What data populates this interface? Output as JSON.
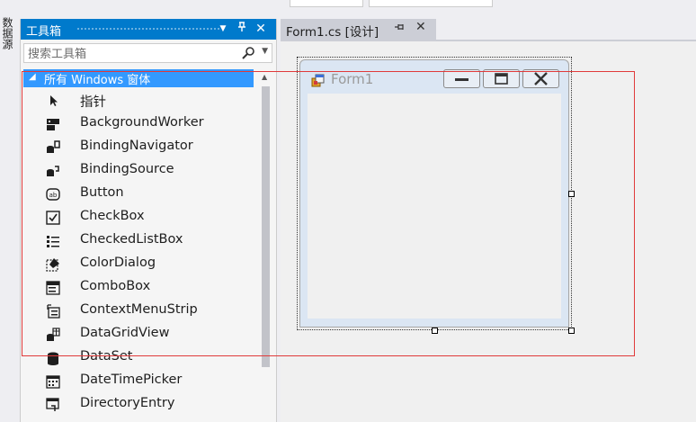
{
  "side_strip": {
    "tab_label": "数据源"
  },
  "toolbox": {
    "title": "工具箱",
    "title_buttons": [
      "▼",
      "📌",
      "✕"
    ],
    "search_placeholder": "搜索工具箱",
    "group": "所有 Windows 窗体",
    "items": [
      {
        "label": "指针",
        "icon": "pointer-icon"
      },
      {
        "label": "BackgroundWorker",
        "icon": "background-worker-icon"
      },
      {
        "label": "BindingNavigator",
        "icon": "binding-navigator-icon"
      },
      {
        "label": "BindingSource",
        "icon": "binding-source-icon"
      },
      {
        "label": "Button",
        "icon": "button-icon"
      },
      {
        "label": "CheckBox",
        "icon": "checkbox-icon"
      },
      {
        "label": "CheckedListBox",
        "icon": "checked-list-box-icon"
      },
      {
        "label": "ColorDialog",
        "icon": "color-dialog-icon"
      },
      {
        "label": "ComboBox",
        "icon": "combo-box-icon"
      },
      {
        "label": "ContextMenuStrip",
        "icon": "context-menu-strip-icon"
      },
      {
        "label": "DataGridView",
        "icon": "data-grid-view-icon"
      },
      {
        "label": "DataSet",
        "icon": "dataset-icon"
      },
      {
        "label": "DateTimePicker",
        "icon": "date-time-picker-icon"
      },
      {
        "label": "DirectoryEntry",
        "icon": "directory-entry-icon"
      }
    ]
  },
  "document_tab": {
    "label": "Form1.cs [设计]"
  },
  "form": {
    "title": "Form1"
  },
  "colors": {
    "accent": "#007acc",
    "group_highlight": "#3399ff",
    "annotation_red": "#e03a3a"
  }
}
